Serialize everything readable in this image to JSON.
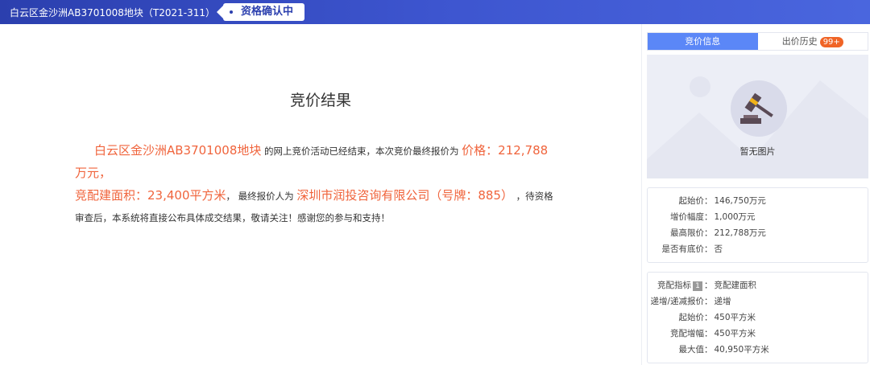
{
  "header": {
    "title": "白云区金沙洲AB3701008地块（T2021-311）",
    "status": "资格确认中"
  },
  "main": {
    "title": "竞价结果",
    "p1": "白云区金沙洲AB3701008地块",
    "p2": " 的网上竞价活动已经结束，本次竞价最终报价为 ",
    "p3": "价格：212,788万元，",
    "p4": "竞配建面积：23,400平方米",
    "p5": "， 最终报价人为 ",
    "p6": "深圳市润投咨询有限公司（号牌：885）",
    "p7": " ，待资格审查后，本系统将直接公布具体成交结果，敬请关注！感谢您的参与和支持！"
  },
  "sidebar": {
    "tabs": [
      {
        "label": "竞价信息"
      },
      {
        "label": "出价历史"
      }
    ],
    "history_count": "99+",
    "no_image": "暂无图片",
    "info": [
      {
        "k": "起始价",
        "v": "146,750万元"
      },
      {
        "k": "增价幅度",
        "v": "1,000万元"
      },
      {
        "k": "最高限价",
        "v": "212,788万元"
      },
      {
        "k": "是否有底价",
        "v": "否"
      }
    ],
    "extra": {
      "index_label": "竞配指标",
      "index_num": "1",
      "index_val": "竞配建面积",
      "rows": [
        {
          "k": "递增/递减报价",
          "v": "递增"
        },
        {
          "k": "起始价",
          "v": "450平方米"
        },
        {
          "k": "竞配增幅",
          "v": "450平方米"
        },
        {
          "k": "最大值",
          "v": "40,950平方米"
        }
      ]
    }
  },
  "colors": {
    "accent": "#5b87f7",
    "highlight": "#f0643c",
    "header": "#2b3fae"
  }
}
